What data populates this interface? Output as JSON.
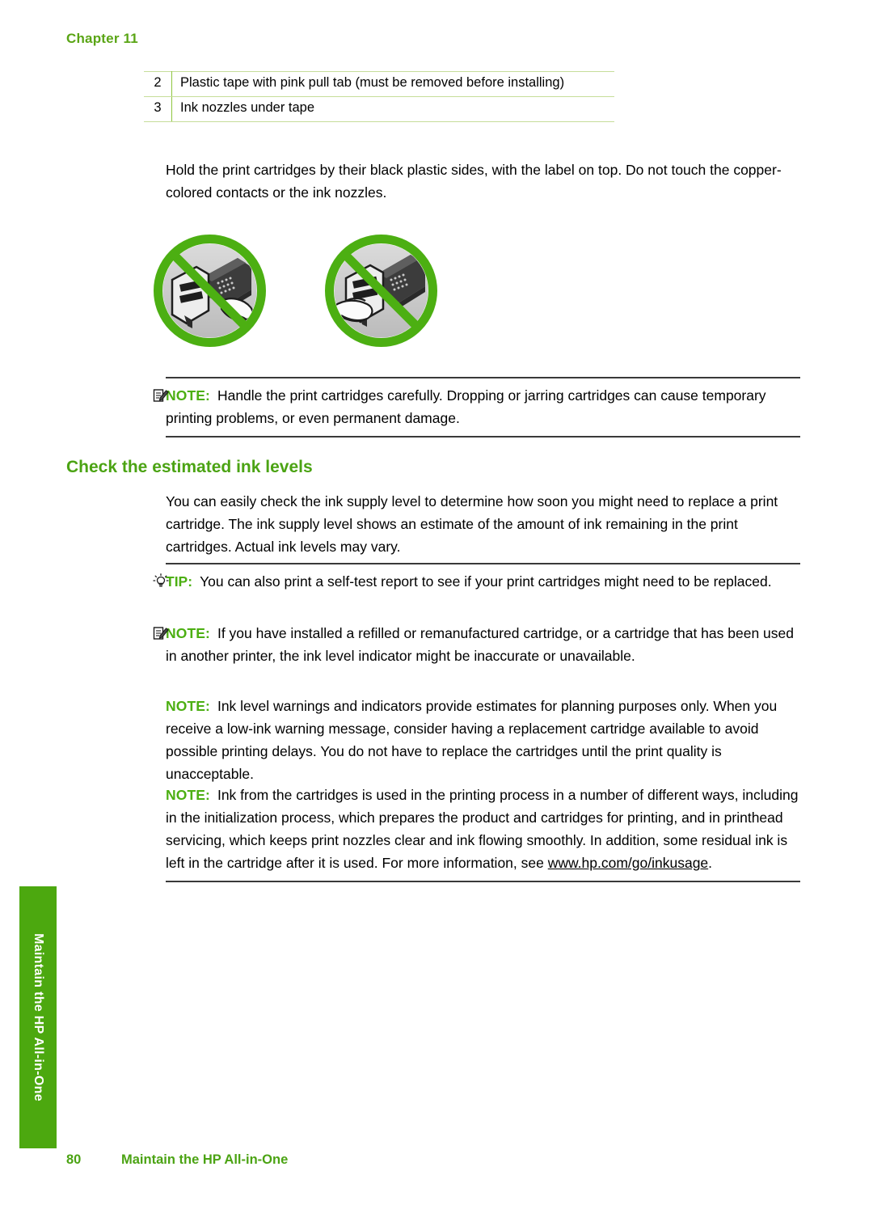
{
  "chapter": {
    "label": "Chapter 11"
  },
  "legend_table": {
    "rows": [
      {
        "num": "2",
        "desc": "Plastic tape with pink pull tab (must be removed before installing)"
      },
      {
        "num": "3",
        "desc": "Ink nozzles under tape"
      }
    ]
  },
  "intro_paragraph": "Hold the print cartridges by their black plastic sides, with the label on top. Do not touch the copper-colored contacts or the ink nozzles.",
  "illustrations": [
    {
      "name": "prohibition-touch-contacts",
      "alt_semantic": "do-not-touch-copper-contacts"
    },
    {
      "name": "prohibition-touch-nozzles",
      "alt_semantic": "do-not-touch-ink-nozzles"
    }
  ],
  "admonitions": {
    "note_handle": {
      "label": "NOTE:",
      "icon": "note-pencil-icon",
      "text": "Handle the print cartridges carefully. Dropping or jarring cartridges can cause temporary printing problems, or even permanent damage."
    },
    "tip_selftest": {
      "label": "TIP:",
      "icon": "lightbulb-icon",
      "text": "You can also print a self-test report to see if your print cartridges might need to be replaced."
    },
    "note_refilled": {
      "label": "NOTE:",
      "icon": "note-pencil-icon",
      "text": "If you have installed a refilled or remanufactured cartridge, or a cartridge that has been used in another printer, the ink level indicator might be inaccurate or unavailable."
    },
    "note_warnings": {
      "label": "NOTE:",
      "text": "Ink level warnings and indicators provide estimates for planning purposes only. When you receive a low-ink warning message, consider having a replacement cartridge available to avoid possible printing delays. You do not have to replace the cartridges until the print quality is unacceptable."
    },
    "note_inkusage": {
      "label": "NOTE:",
      "text_before": "Ink from the cartridges is used in the printing process in a number of different ways, including in the initialization process, which prepares the product and cartridges for printing, and in printhead servicing, which keeps print nozzles clear and ink flowing smoothly. In addition, some residual ink is left in the cartridge after it is used. For more information, see ",
      "link_text": "www.hp.com/go/inkusage",
      "text_after": "."
    }
  },
  "section_heading": "Check the estimated ink levels",
  "section_paragraph": "You can easily check the ink supply level to determine how soon you might need to replace a print cartridge. The ink supply level shows an estimate of the amount of ink remaining in the print cartridges. Actual ink levels may vary.",
  "side_tab": {
    "label": "Maintain the HP All-in-One"
  },
  "footer": {
    "page_number": "80",
    "title": "Maintain the HP All-in-One"
  },
  "colors": {
    "brand_green": "#4ba313",
    "tab_green": "#4ca80f",
    "table_border_green": "#c6dd9a",
    "rule_dark": "#3a3a3a"
  }
}
